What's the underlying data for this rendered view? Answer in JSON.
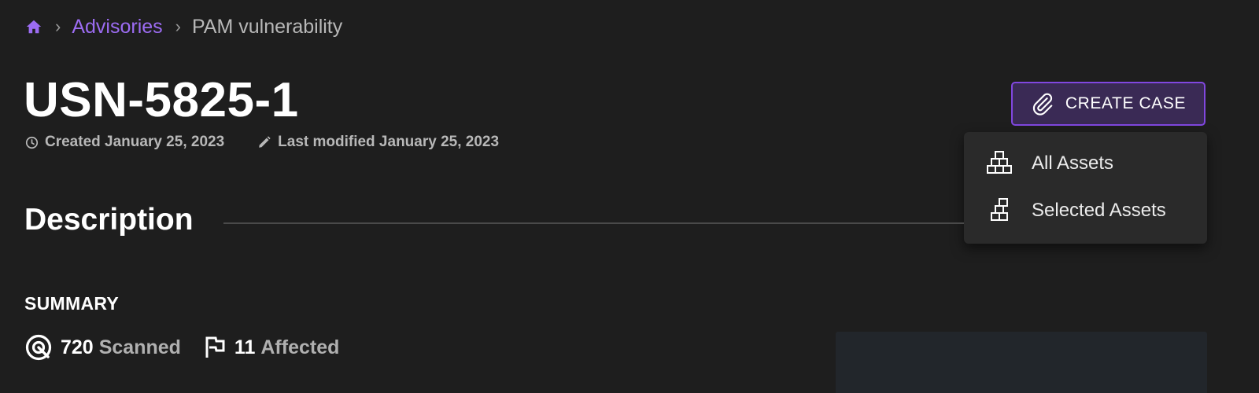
{
  "breadcrumb": {
    "home_icon": "home-icon",
    "separator": "›",
    "parent": "Advisories",
    "current": "PAM vulnerability",
    "link_color": "#9c6cf2"
  },
  "advisory": {
    "title": "USN-5825-1",
    "created": "Created January 25, 2023",
    "modified": "Last modified January 25, 2023"
  },
  "actions": {
    "create_case_label": "CREATE CASE",
    "create_case_icon": "paperclip-icon",
    "accent_color": "#8147e0",
    "menu": [
      {
        "label": "All Assets",
        "icon": "all-assets-icon"
      },
      {
        "label": "Selected Assets",
        "icon": "selected-assets-icon"
      }
    ]
  },
  "description": {
    "heading": "Description",
    "summary_label": "SUMMARY",
    "scanned_count": "720",
    "scanned_label": "Scanned",
    "affected_count": "11",
    "affected_label": "Affected"
  }
}
